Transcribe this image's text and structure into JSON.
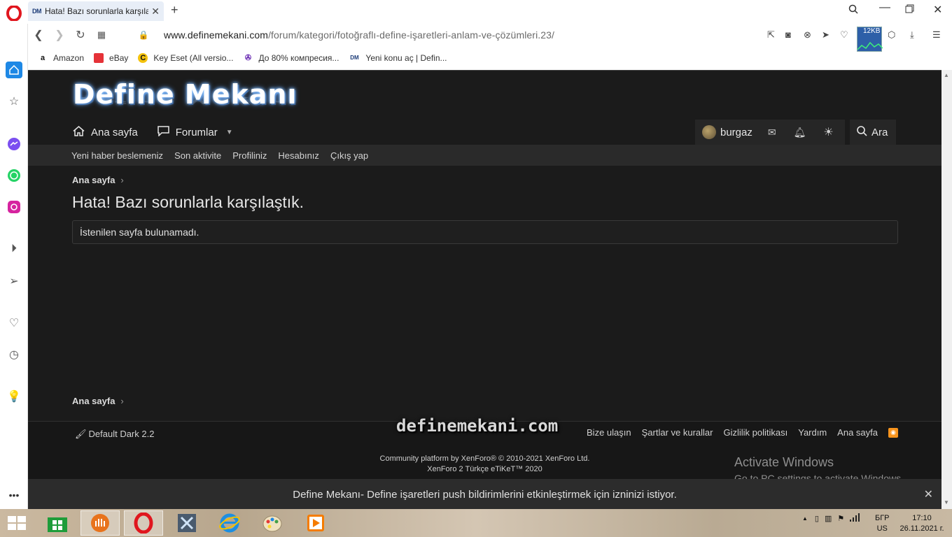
{
  "browser": {
    "tab_title": "Hata! Bazı sorunlarla karşılaştık.",
    "tab_favicon": "DM",
    "url_host": "www.definemekani.com",
    "url_path": "/forum/kategori/fotoğraflı-define-işaretleri-anlam-ve-çözümleri.23/",
    "speed_badge": "12KB",
    "bookmarks": [
      {
        "label": "Amazon",
        "icon": "a"
      },
      {
        "label": "eBay",
        "icon": "🛍"
      },
      {
        "label": "Key Eset (All versio...",
        "icon": "C"
      },
      {
        "label": "До 80% компресия...",
        "icon": "✇"
      },
      {
        "label": "Yeni konu aç | Defin...",
        "icon": "DM"
      }
    ]
  },
  "site": {
    "logo_text": "Define Mekanı",
    "nav": {
      "home": "Ana sayfa",
      "forums": "Forumlar"
    },
    "user": {
      "name": "burgaz",
      "search": "Ara"
    },
    "subnav": [
      "Yeni haber beslemeniz",
      "Son aktivite",
      "Profiliniz",
      "Hesabınız",
      "Çıkış yap"
    ],
    "breadcrumb_top": "Ana sayfa",
    "page_title": "Hata! Bazı sorunlarla karşılaştık.",
    "error_message": "İstenilen sayfa bulunamadı.",
    "breadcrumb_bottom": "Ana sayfa"
  },
  "footer": {
    "style_chooser": "Default Dark 2.2",
    "watermark": "definemekani.com",
    "links": [
      "Bize ulaşın",
      "Şartlar ve kurallar",
      "Gizlilik politikası",
      "Yardım",
      "Ana sayfa"
    ],
    "copyright_line1": "Community platform by XenForo® © 2010-2021 XenForo Ltd.",
    "copyright_line2": "XenForo 2 Türkçe eTiKeT™ 2020"
  },
  "windows_watermark": {
    "line1": "Activate Windows",
    "line2": "Go to PC settings to activate Windows."
  },
  "push_notice": "Define Mekanı- Define işaretleri push bildirimlerini etkinleştirmek için izninizi istiyor.",
  "taskbar": {
    "lang_line1": "БГР",
    "lang_line2": "US",
    "time": "17:10",
    "date": "26.11.2021 г."
  }
}
